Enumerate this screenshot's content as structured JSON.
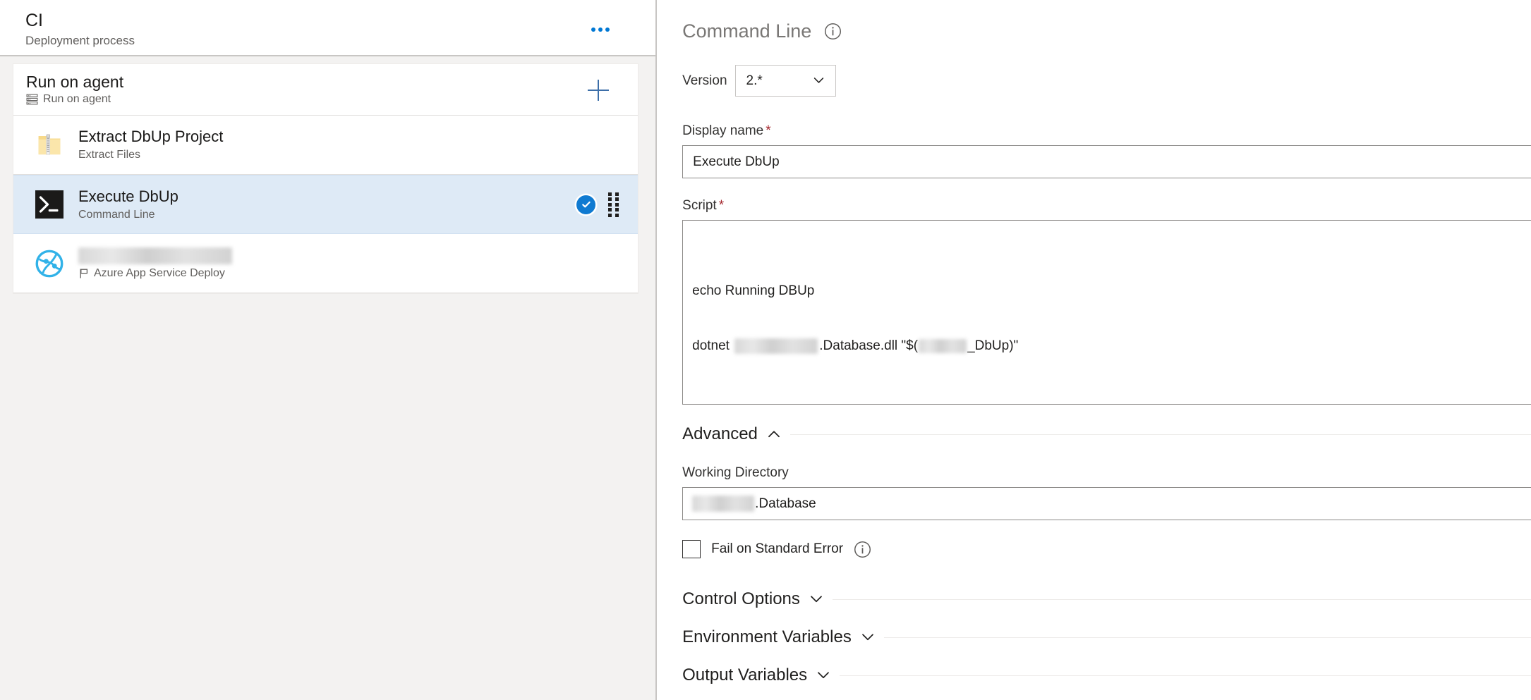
{
  "left_panel": {
    "process": {
      "title": "CI",
      "subtitle": "Deployment process",
      "more_menu_icon": "ellipsis-icon"
    },
    "phase": {
      "name": "Run on agent",
      "meta": "Run on agent",
      "meta_icon": "agent-pool-icon",
      "add_icon": "plus-icon"
    },
    "tasks": [
      {
        "name": "Extract DbUp Project",
        "subtitle": "Extract Files",
        "icon": "zip-folder-icon",
        "selected": false,
        "name_redacted": false
      },
      {
        "name": "Execute DbUp",
        "subtitle": "Command Line",
        "icon": "console-terminal-icon",
        "selected": true,
        "name_redacted": false,
        "status_icon": "check-circle-icon",
        "drag_icon": "drag-handle-icon"
      },
      {
        "name": "",
        "subtitle": "Azure App Service Deploy",
        "subtitle_icon": "flag-icon",
        "icon": "azure-web-app-icon",
        "selected": false,
        "name_redacted": true
      }
    ]
  },
  "right_panel": {
    "task_header": {
      "title": "Command Line",
      "info_icon": "info-icon"
    },
    "version": {
      "label": "Version",
      "value": "2.*",
      "chevron_icon": "chevron-down-icon"
    },
    "display_name": {
      "label": "Display name",
      "required_marker": "*",
      "value": "Execute DbUp",
      "placeholder": ""
    },
    "script": {
      "label": "Script",
      "required_marker": "*",
      "line1": "echo Running DBUp",
      "line2_prefix": "dotnet ",
      "line2_mid": ".Database.dll \"$(",
      "line2_suffix": "_DbUp)\"",
      "placeholder": ""
    },
    "advanced": {
      "title": "Advanced",
      "caret_icon": "chevron-up-icon",
      "working_directory": {
        "label": "Working Directory",
        "value": ".Database",
        "placeholder": ""
      },
      "fail_on_standard_error": {
        "label": "Fail on Standard Error",
        "checked": false,
        "info_icon": "info-icon"
      }
    },
    "sections": [
      {
        "title": "Control Options",
        "caret_icon": "chevron-down-icon"
      },
      {
        "title": "Environment Variables",
        "caret_icon": "chevron-down-icon"
      },
      {
        "title": "Output Variables",
        "caret_icon": "chevron-down-icon"
      }
    ]
  },
  "colors": {
    "accent": "#0078d4",
    "selected_row": "#deeaf6",
    "required_marker": "#a4262c",
    "muted_text": "#605e5c",
    "panel_bg": "#f3f2f1"
  }
}
